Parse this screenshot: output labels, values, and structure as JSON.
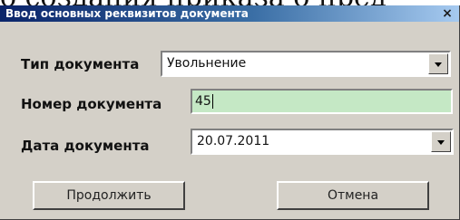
{
  "background_text": "о создания приказа о пред",
  "dialog": {
    "title": "Ввод основных реквизитов документа",
    "close_glyph": "×"
  },
  "fields": {
    "doc_type": {
      "label": "Тип документа",
      "value": "Увольнение"
    },
    "doc_number": {
      "label": "Номер документа",
      "value": "45"
    },
    "doc_date": {
      "label": "Дата документа",
      "value": "20.07.2011"
    }
  },
  "buttons": {
    "continue": "Продолжить",
    "cancel": "Отмена"
  },
  "colors": {
    "title_gradient_start": "#0a246a",
    "title_gradient_end": "#a6caf0",
    "input_highlight": "#c5e8c5",
    "dialog_face": "#d4d0c8"
  },
  "icons": {
    "close": "close-icon",
    "dropdown": "chevron-down-icon"
  }
}
